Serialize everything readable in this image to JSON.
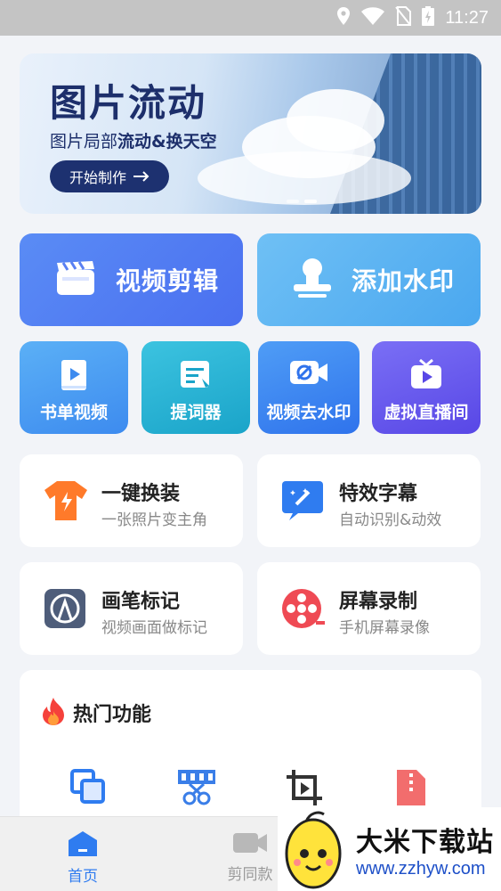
{
  "status": {
    "time": "11:27"
  },
  "banner": {
    "title": "图片流动",
    "subtitle_a": "图片局部",
    "subtitle_b": "流动&换天空",
    "cta": "开始制作"
  },
  "big_actions": [
    {
      "label": "视频剪辑",
      "icon": "clapperboard-icon"
    },
    {
      "label": "添加水印",
      "icon": "stamp-icon"
    }
  ],
  "small_actions": [
    {
      "label": "书单视频",
      "icon": "book-video-icon",
      "color": "#4b9cf1"
    },
    {
      "label": "提词器",
      "icon": "teleprompter-icon",
      "color": "#22b0cf"
    },
    {
      "label": "视频去水印",
      "icon": "remove-watermark-icon",
      "color": "#3f86f2"
    },
    {
      "label": "虚拟直播间",
      "icon": "live-tv-icon",
      "color": "#6a5ff0"
    }
  ],
  "feature_cards": [
    {
      "title": "一键换装",
      "subtitle": "一张照片变主角",
      "icon": "tshirt-icon"
    },
    {
      "title": "特效字幕",
      "subtitle": "自动识别&动效",
      "icon": "subtitle-effect-icon"
    },
    {
      "title": "画笔标记",
      "subtitle": "视频画面做标记",
      "icon": "pen-mark-icon"
    },
    {
      "title": "屏幕录制",
      "subtitle": "手机屏幕录像",
      "icon": "screen-record-icon"
    }
  ],
  "hot": {
    "title": "热门功能",
    "icons": [
      "merge-icon",
      "video-cut-icon",
      "crop-icon",
      "zip-icon"
    ]
  },
  "tabs": [
    {
      "label": "首页",
      "active": true
    },
    {
      "label": "剪同款",
      "active": false
    }
  ],
  "watermark": {
    "name": "大米下载站",
    "url": "www.zzhyw.com"
  }
}
